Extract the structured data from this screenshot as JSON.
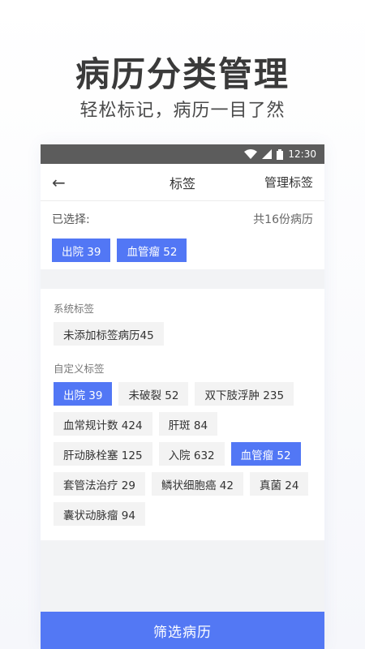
{
  "hero": {
    "title": "病历分类管理",
    "subtitle": "轻松标记，病历一目了然"
  },
  "status_bar": {
    "time": "12:30",
    "icons": [
      "wifi-icon",
      "signal-icon",
      "battery-icon"
    ]
  },
  "app_bar": {
    "back_icon": "arrow-left-icon",
    "back_glyph": "←",
    "title": "标签",
    "manage_label": "管理标签"
  },
  "selected": {
    "label": "已选择:",
    "count_text": "共16份病历",
    "tags": [
      {
        "text": "出院 39",
        "active": true
      },
      {
        "text": "血管瘤 52",
        "active": true
      }
    ]
  },
  "system_tags": {
    "label": "系统标签",
    "tags": [
      {
        "text": "未添加标签病历45",
        "active": false
      }
    ]
  },
  "custom_tags": {
    "label": "自定义标签",
    "tags": [
      {
        "text": "出院 39",
        "active": true
      },
      {
        "text": "未破裂 52",
        "active": false
      },
      {
        "text": "双下肢浮肿 235",
        "active": false
      },
      {
        "text": "血常规计数 424",
        "active": false
      },
      {
        "text": "肝斑 84",
        "active": false
      },
      {
        "text": "肝动脉栓塞 125",
        "active": false
      },
      {
        "text": "入院 632",
        "active": false
      },
      {
        "text": "血管瘤 52",
        "active": true
      },
      {
        "text": "套管法治疗 29",
        "active": false
      },
      {
        "text": "鳞状细胞癌 42",
        "active": false
      },
      {
        "text": "真菌 24",
        "active": false
      },
      {
        "text": "囊状动脉瘤 94",
        "active": false
      }
    ]
  },
  "bottom_button": {
    "label": "筛选病历"
  },
  "colors": {
    "accent": "#5277f5",
    "status_bar": "#5c5c5c",
    "tag_bg": "#f3f3f3"
  }
}
